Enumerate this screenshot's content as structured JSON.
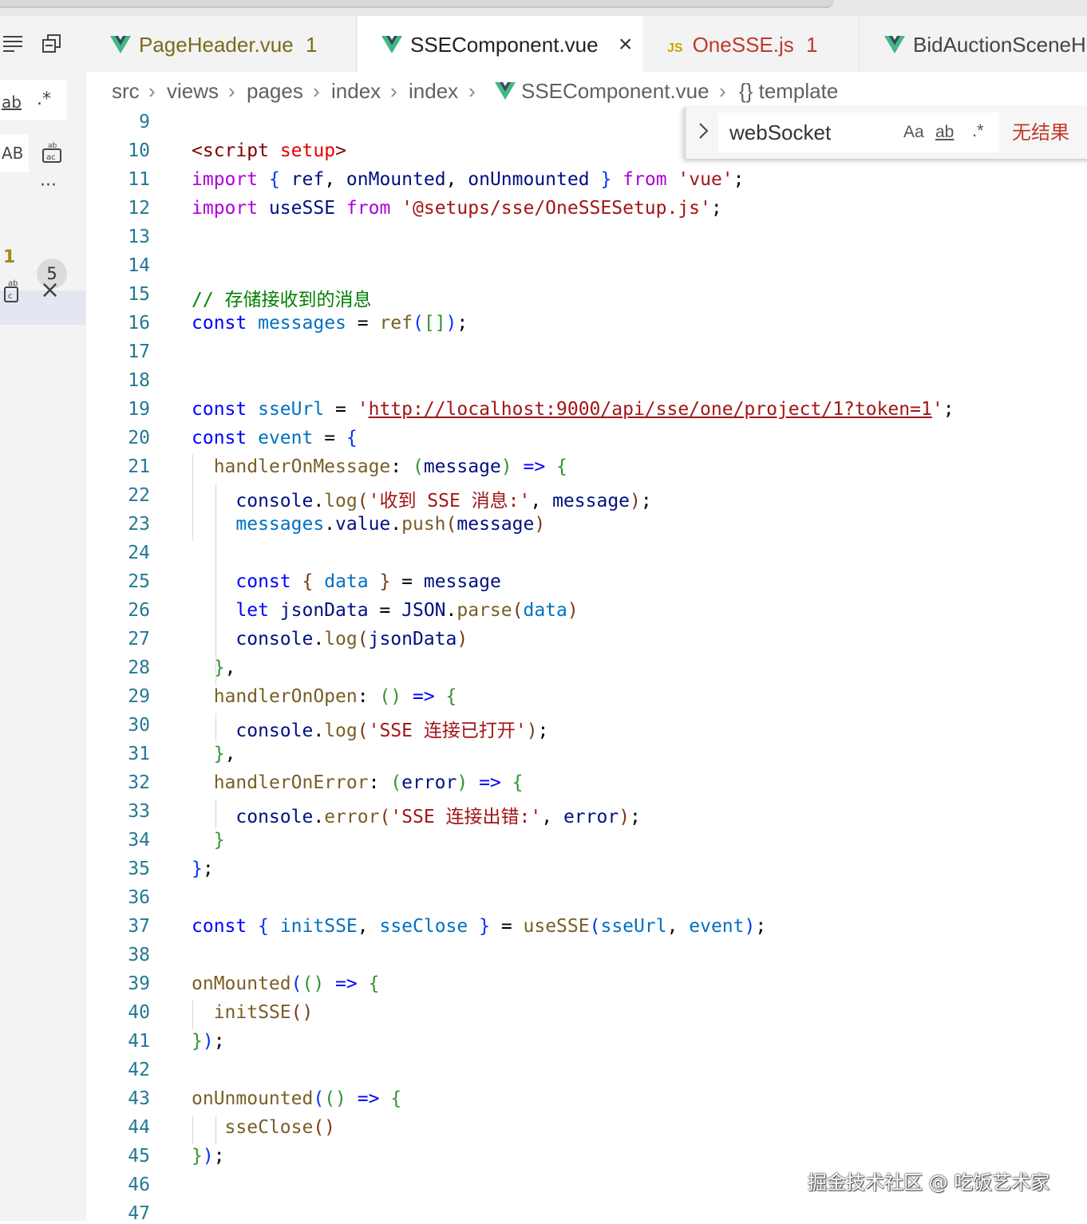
{
  "tabs": [
    {
      "name": "PageHeader.vue",
      "icon": "vue-icon",
      "problems": "1",
      "color": "#7a6a1a"
    },
    {
      "name": "SSEComponent.vue",
      "icon": "vue-icon",
      "close": "×",
      "active": true
    },
    {
      "name": "OneSSE.js",
      "icon": "js-icon",
      "icon_text": "JS",
      "problems": "1",
      "color": "#c0392b"
    },
    {
      "name": "BidAuctionSceneH",
      "icon": "vue-icon"
    }
  ],
  "breadcrumb": [
    "src",
    "views",
    "pages",
    "index",
    "index",
    "SSEComponent.vue",
    "{} template"
  ],
  "left_panel": {
    "item_ab": "ab",
    "item_AB": "AB",
    "more": "···",
    "count_label": "1",
    "badge": "5",
    "close": "×"
  },
  "find": {
    "query": "webSocket",
    "case_label": "Aa",
    "word_label": "ab",
    "regex_label": ".*",
    "result": "无结果"
  },
  "code": {
    "first_line": 9,
    "lines": [
      [],
      [
        [
          "<",
          "tag"
        ],
        [
          "script",
          "tag"
        ],
        [
          " "
        ],
        [
          "setup",
          "attr"
        ],
        [
          ">",
          "tag"
        ]
      ],
      [
        [
          "import",
          "kw2"
        ],
        [
          " "
        ],
        [
          "{",
          "p1"
        ],
        [
          " "
        ],
        [
          "ref",
          "id"
        ],
        [
          ", "
        ],
        [
          "onMounted",
          "id"
        ],
        [
          ", "
        ],
        [
          "onUnmounted",
          "id"
        ],
        [
          " "
        ],
        [
          "}",
          "p1"
        ],
        [
          " "
        ],
        [
          "from",
          "kw2"
        ],
        [
          " "
        ],
        [
          "'vue'",
          "str"
        ],
        [
          ";"
        ]
      ],
      [
        [
          "import",
          "kw2"
        ],
        [
          " "
        ],
        [
          "useSSE",
          "id"
        ],
        [
          " "
        ],
        [
          "from",
          "kw2"
        ],
        [
          " "
        ],
        [
          "'@setups/sse/OneSSESetup.js'",
          "str"
        ],
        [
          ";"
        ]
      ],
      [],
      [],
      [
        [
          "// 存储接收到的消息",
          "cm"
        ]
      ],
      [
        [
          "const",
          "kw"
        ],
        [
          " "
        ],
        [
          "messages",
          "var"
        ],
        [
          " = "
        ],
        [
          "ref",
          "fn"
        ],
        [
          "(",
          "p1"
        ],
        [
          "[]",
          "p2"
        ],
        [
          ")",
          "p1"
        ],
        [
          ";"
        ]
      ],
      [],
      [],
      [
        [
          "const",
          "kw"
        ],
        [
          " "
        ],
        [
          "sseUrl",
          "var"
        ],
        [
          " = "
        ],
        [
          "'",
          "str"
        ],
        [
          "http://localhost:9000/api/sse/one/project/1?token=1",
          "str link"
        ],
        [
          "'",
          "str"
        ],
        [
          ";"
        ]
      ],
      [
        [
          "const",
          "kw"
        ],
        [
          " "
        ],
        [
          "event",
          "var"
        ],
        [
          " = "
        ],
        [
          "{",
          "p1"
        ]
      ],
      [
        [
          "  "
        ],
        [
          "handlerOnMessage",
          "fn"
        ],
        [
          ": "
        ],
        [
          "(",
          "p2"
        ],
        [
          "message",
          "id"
        ],
        [
          ")",
          "p2"
        ],
        [
          " "
        ],
        [
          "=>",
          "kw"
        ],
        [
          " "
        ],
        [
          "{",
          "p2"
        ]
      ],
      [
        [
          "    "
        ],
        [
          "console",
          "id"
        ],
        [
          "."
        ],
        [
          "log",
          "fn"
        ],
        [
          "(",
          "p3"
        ],
        [
          "'收到 SSE 消息:'",
          "str"
        ],
        [
          ", "
        ],
        [
          "message",
          "id"
        ],
        [
          ")",
          "p3"
        ],
        [
          ";"
        ]
      ],
      [
        [
          "    "
        ],
        [
          "messages",
          "var"
        ],
        [
          "."
        ],
        [
          "value",
          "id"
        ],
        [
          "."
        ],
        [
          "push",
          "fn"
        ],
        [
          "(",
          "p3"
        ],
        [
          "message",
          "id"
        ],
        [
          ")",
          "p3"
        ]
      ],
      [],
      [
        [
          "    "
        ],
        [
          "const",
          "kw"
        ],
        [
          " "
        ],
        [
          "{",
          "p3"
        ],
        [
          " "
        ],
        [
          "data",
          "var"
        ],
        [
          " "
        ],
        [
          "}",
          "p3"
        ],
        [
          " = "
        ],
        [
          "message",
          "id"
        ]
      ],
      [
        [
          "    "
        ],
        [
          "let",
          "kw"
        ],
        [
          " "
        ],
        [
          "jsonData",
          "id"
        ],
        [
          " = "
        ],
        [
          "JSON",
          "id"
        ],
        [
          "."
        ],
        [
          "parse",
          "fn"
        ],
        [
          "(",
          "p3"
        ],
        [
          "data",
          "var"
        ],
        [
          ")",
          "p3"
        ]
      ],
      [
        [
          "    "
        ],
        [
          "console",
          "id"
        ],
        [
          "."
        ],
        [
          "log",
          "fn"
        ],
        [
          "(",
          "p3"
        ],
        [
          "jsonData",
          "id"
        ],
        [
          ")",
          "p3"
        ]
      ],
      [
        [
          "  "
        ],
        [
          "}",
          "p2"
        ],
        [
          ","
        ]
      ],
      [
        [
          "  "
        ],
        [
          "handlerOnOpen",
          "fn"
        ],
        [
          ": "
        ],
        [
          "()",
          "p2"
        ],
        [
          " "
        ],
        [
          "=>",
          "kw"
        ],
        [
          " "
        ],
        [
          "{",
          "p2"
        ]
      ],
      [
        [
          "    "
        ],
        [
          "console",
          "id"
        ],
        [
          "."
        ],
        [
          "log",
          "fn"
        ],
        [
          "(",
          "p3"
        ],
        [
          "'SSE 连接已打开'",
          "str"
        ],
        [
          ")",
          "p3"
        ],
        [
          ";"
        ]
      ],
      [
        [
          "  "
        ],
        [
          "}",
          "p2"
        ],
        [
          ","
        ]
      ],
      [
        [
          "  "
        ],
        [
          "handlerOnError",
          "fn"
        ],
        [
          ": "
        ],
        [
          "(",
          "p2"
        ],
        [
          "error",
          "id"
        ],
        [
          ")",
          "p2"
        ],
        [
          " "
        ],
        [
          "=>",
          "kw"
        ],
        [
          " "
        ],
        [
          "{",
          "p2"
        ]
      ],
      [
        [
          "    "
        ],
        [
          "console",
          "id"
        ],
        [
          "."
        ],
        [
          "error",
          "fn"
        ],
        [
          "(",
          "p3"
        ],
        [
          "'SSE 连接出错:'",
          "str"
        ],
        [
          ", "
        ],
        [
          "error",
          "id"
        ],
        [
          ")",
          "p3"
        ],
        [
          ";"
        ]
      ],
      [
        [
          "  "
        ],
        [
          "}",
          "p2"
        ]
      ],
      [
        [
          "}",
          "p1"
        ],
        [
          ";"
        ]
      ],
      [],
      [
        [
          "const",
          "kw"
        ],
        [
          " "
        ],
        [
          "{",
          "p1"
        ],
        [
          " "
        ],
        [
          "initSSE",
          "var"
        ],
        [
          ", "
        ],
        [
          "sseClose",
          "var"
        ],
        [
          " "
        ],
        [
          "}",
          "p1"
        ],
        [
          " = "
        ],
        [
          "useSSE",
          "fn"
        ],
        [
          "(",
          "p1"
        ],
        [
          "sseUrl",
          "var"
        ],
        [
          ", "
        ],
        [
          "event",
          "var"
        ],
        [
          ")",
          "p1"
        ],
        [
          ";"
        ]
      ],
      [],
      [
        [
          "onMounted",
          "fn"
        ],
        [
          "(",
          "p1"
        ],
        [
          "()",
          "p2"
        ],
        [
          " "
        ],
        [
          "=>",
          "kw"
        ],
        [
          " "
        ],
        [
          "{",
          "p2"
        ]
      ],
      [
        [
          "  "
        ],
        [
          "initSSE",
          "fn"
        ],
        [
          "()",
          "p3"
        ]
      ],
      [
        [
          "}",
          "p2"
        ],
        [
          ")",
          "p1"
        ],
        [
          ";"
        ]
      ],
      [],
      [
        [
          "onUnmounted",
          "fn"
        ],
        [
          "(",
          "p1"
        ],
        [
          "()",
          "p2"
        ],
        [
          " "
        ],
        [
          "=>",
          "kw"
        ],
        [
          " "
        ],
        [
          "{",
          "p2"
        ]
      ],
      [
        [
          "   "
        ],
        [
          "sseClose",
          "fn"
        ],
        [
          "()",
          "p3"
        ]
      ],
      [
        [
          "}",
          "p2"
        ],
        [
          ")",
          "p1"
        ],
        [
          ";"
        ]
      ],
      [],
      []
    ]
  },
  "watermark": "掘金技术社区 @ 吃饭艺术家",
  "colors": {
    "keyword": "#0000ff",
    "control": "#af00db",
    "string": "#a31515",
    "comment": "#008000",
    "variable": "#0070c1",
    "line_number": "#237893"
  }
}
